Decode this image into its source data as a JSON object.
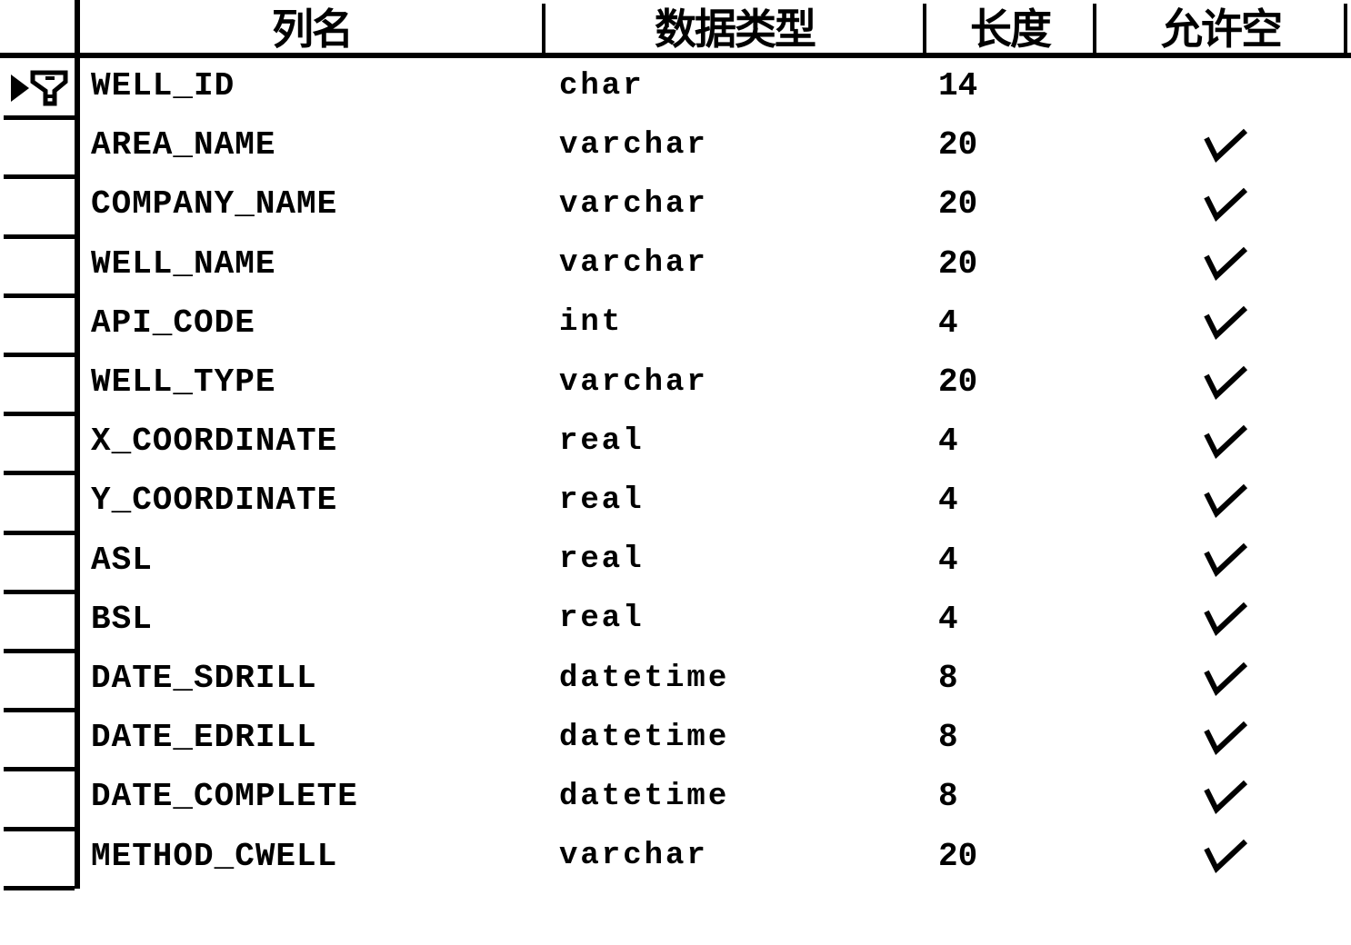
{
  "table_designer": {
    "columns": [
      {
        "key": "name",
        "label": "列名"
      },
      {
        "key": "type",
        "label": "数据类型"
      },
      {
        "key": "length",
        "label": "长度"
      },
      {
        "key": "nullable",
        "label": "允许空"
      }
    ],
    "rows": [
      {
        "name": "WELL_ID",
        "type": "char",
        "length": "14",
        "nullable": false,
        "primary_key": true,
        "current": true
      },
      {
        "name": "AREA_NAME",
        "type": "varchar",
        "length": "20",
        "nullable": true
      },
      {
        "name": "COMPANY_NAME",
        "type": "varchar",
        "length": "20",
        "nullable": true
      },
      {
        "name": "WELL_NAME",
        "type": "varchar",
        "length": "20",
        "nullable": true
      },
      {
        "name": "API_CODE",
        "type": "int",
        "length": "4",
        "nullable": true
      },
      {
        "name": "WELL_TYPE",
        "type": "varchar",
        "length": "20",
        "nullable": true
      },
      {
        "name": "X_COORDINATE",
        "type": "real",
        "length": "4",
        "nullable": true
      },
      {
        "name": "Y_COORDINATE",
        "type": "real",
        "length": "4",
        "nullable": true
      },
      {
        "name": "ASL",
        "type": "real",
        "length": "4",
        "nullable": true
      },
      {
        "name": "BSL",
        "type": "real",
        "length": "4",
        "nullable": true
      },
      {
        "name": "DATE_SDRILL",
        "type": "datetime",
        "length": "8",
        "nullable": true
      },
      {
        "name": "DATE_EDRILL",
        "type": "datetime",
        "length": "8",
        "nullable": true
      },
      {
        "name": "DATE_COMPLETE",
        "type": "datetime",
        "length": "8",
        "nullable": true
      },
      {
        "name": "METHOD_CWELL",
        "type": "varchar",
        "length": "20",
        "nullable": true
      }
    ],
    "icons": {
      "current_row": "row-pointer-icon",
      "primary_key": "key-icon",
      "nullable": "checkmark-icon"
    }
  }
}
